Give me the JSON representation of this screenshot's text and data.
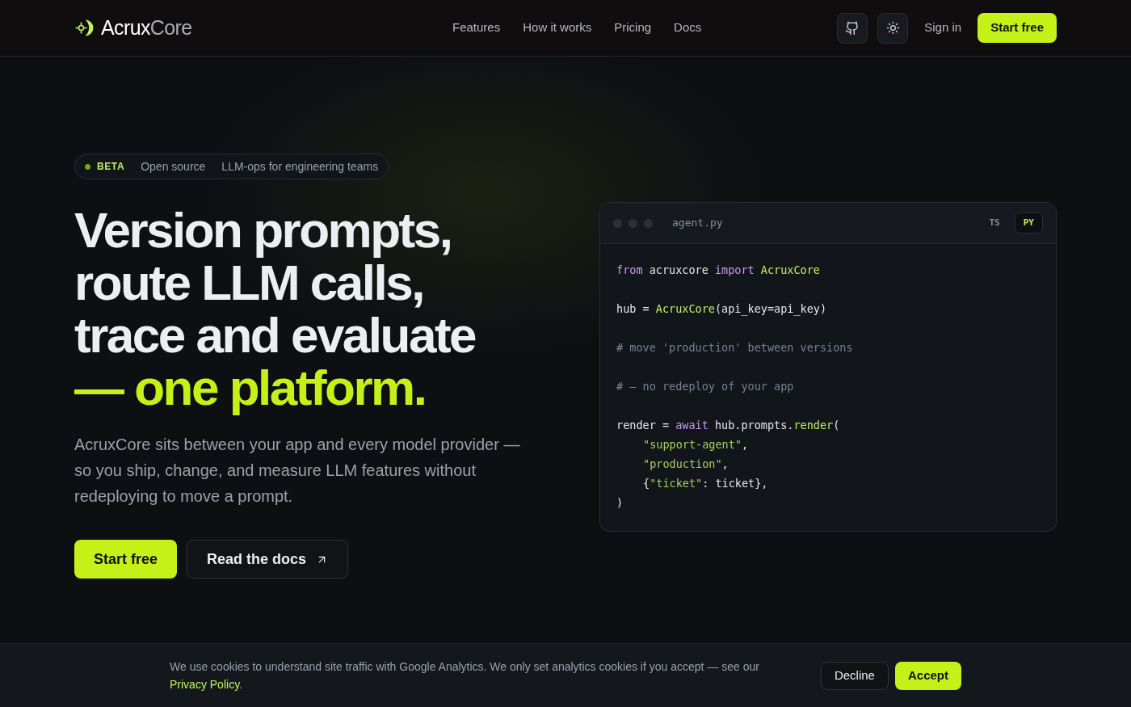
{
  "brand": {
    "parts": [
      {
        "text": "Acrux",
        "muted": false
      },
      {
        "text": "Core",
        "muted": true
      }
    ]
  },
  "nav": [
    "Features",
    "How it works",
    "Pricing",
    "Docs"
  ],
  "header_actions": {
    "sign_in": "Sign in",
    "cta": "Start free"
  },
  "badge": {
    "tag": "BETA",
    "items": [
      "Open source",
      "LLM-ops for engineering teams"
    ]
  },
  "headline": [
    {
      "text": "Version prompts,",
      "accent": false
    },
    {
      "text": "route LLM calls,",
      "accent": false
    },
    {
      "text": "trace and evaluate",
      "accent": false
    },
    {
      "text": "— one platform.",
      "accent": true
    }
  ],
  "lead": "AcruxCore sits between your app and every model provider — so you ship, change, and measure LLM features without redeploying to move a prompt.",
  "buttons": {
    "primary": "Start free",
    "secondary": "Read the docs"
  },
  "code": {
    "filename": "agent.py",
    "tabs": [
      {
        "label": "TS",
        "selected": false
      },
      {
        "label": "PY",
        "selected": true
      }
    ],
    "lines": [
      {
        "spaced": false,
        "indent": false,
        "tokens": [
          {
            "kind": "kw",
            "text": "from"
          },
          {
            "kind": "plain",
            "text": " acruxcore "
          },
          {
            "kind": "kw",
            "text": "import"
          },
          {
            "kind": "fn",
            "text": " AcruxCore"
          }
        ]
      },
      {
        "spaced": true,
        "indent": false,
        "tokens": [
          {
            "kind": "plain",
            "text": "hub = "
          },
          {
            "kind": "fn",
            "text": "AcruxCore"
          },
          {
            "kind": "plain",
            "text": "(api_key=api_key)"
          }
        ]
      },
      {
        "spaced": true,
        "indent": false,
        "tokens": [
          {
            "kind": "comment",
            "text": "# move 'production' between versions"
          }
        ]
      },
      {
        "spaced": true,
        "indent": false,
        "tokens": [
          {
            "kind": "comment",
            "text": "# — no redeploy of your app"
          }
        ]
      },
      {
        "spaced": true,
        "indent": false,
        "tokens": [
          {
            "kind": "plain",
            "text": "render = "
          },
          {
            "kind": "kw",
            "text": "await"
          },
          {
            "kind": "plain",
            "text": " hub.prompts."
          },
          {
            "kind": "fn",
            "text": "render"
          },
          {
            "kind": "plain",
            "text": "("
          }
        ]
      },
      {
        "spaced": false,
        "indent": true,
        "tokens": [
          {
            "kind": "str",
            "text": "\"support-agent\""
          },
          {
            "kind": "plain",
            "text": ","
          }
        ]
      },
      {
        "spaced": false,
        "indent": true,
        "tokens": [
          {
            "kind": "str",
            "text": "\"production\""
          },
          {
            "kind": "plain",
            "text": ","
          }
        ]
      },
      {
        "spaced": false,
        "indent": true,
        "tokens": [
          {
            "kind": "plain",
            "text": "{"
          },
          {
            "kind": "str",
            "text": "\"ticket\""
          },
          {
            "kind": "plain",
            "text": ": ticket},"
          }
        ]
      },
      {
        "spaced": false,
        "indent": false,
        "tokens": [
          {
            "kind": "plain",
            "text": ")"
          }
        ]
      }
    ]
  },
  "cookie": {
    "text": "We use cookies to understand site traffic with Google Analytics. We only set analytics cookies if you accept — see our",
    "link": "Privacy Policy",
    "after": ".",
    "decline": "Decline",
    "accept": "Accept"
  }
}
